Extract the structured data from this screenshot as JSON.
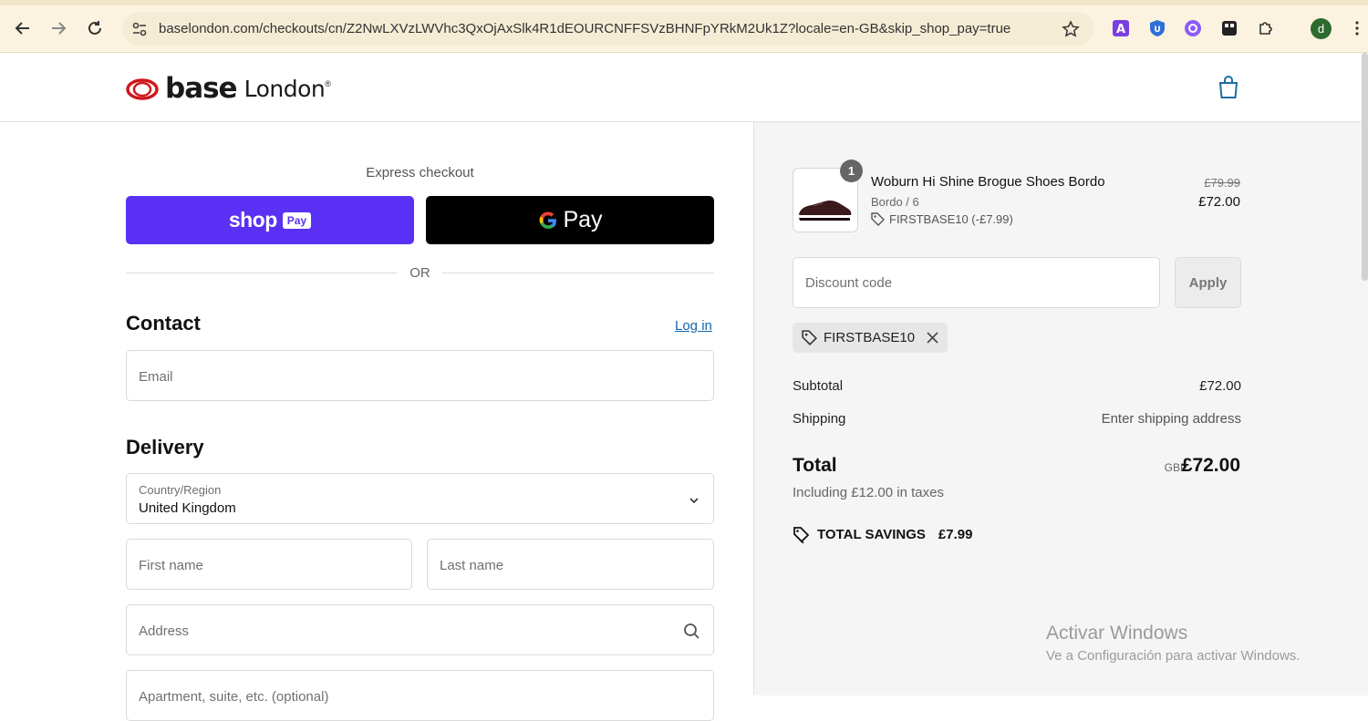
{
  "browser": {
    "url": "baselondon.com/checkouts/cn/Z2NwLXVzLWVhc3QxOjAxSlk4R1dEOURCNFFSVzBHNFpYRkM2Uk1Z?locale=en-GB&skip_shop_pay=true",
    "avatar_letter": "d",
    "extensions": [
      "translate-icon",
      "shield-icon",
      "vpn-icon",
      "tracker-icon",
      "puzzle-icon"
    ]
  },
  "header": {
    "logo_base": "base",
    "logo_london": "London",
    "logo_reg": "®"
  },
  "express": {
    "label": "Express checkout",
    "shoppay_shop": "shop",
    "shoppay_pay": "Pay",
    "gpay_g": "G",
    "gpay_pay": "Pay",
    "or": "OR"
  },
  "contact": {
    "title": "Contact",
    "login": "Log in",
    "email_placeholder": "Email"
  },
  "delivery": {
    "title": "Delivery",
    "country_label": "Country/Region",
    "country_value": "United Kingdom",
    "first_name": "First name",
    "last_name": "Last name",
    "address": "Address",
    "apartment": "Apartment, suite, etc. (optional)"
  },
  "summary": {
    "qty": "1",
    "product_name": "Woburn Hi Shine Brogue Shoes Bordo",
    "variant": "Bordo / 6",
    "discount_line": "FIRSTBASE10 (-£7.99)",
    "price_old": "£79.99",
    "price_new": "£72.00",
    "discount_placeholder": "Discount code",
    "apply": "Apply",
    "applied_code": "FIRSTBASE10",
    "subtotal_label": "Subtotal",
    "subtotal_value": "£72.00",
    "shipping_label": "Shipping",
    "shipping_value": "Enter shipping address",
    "total_label": "Total",
    "total_currency": "GBP",
    "total_value": "£72.00",
    "taxes": "Including £12.00 in taxes",
    "savings_label": "TOTAL SAVINGS",
    "savings_value": "£7.99"
  },
  "watermark": {
    "line1": "Activar Windows",
    "line2": "Ve a Configuración para activar Windows."
  },
  "colors": {
    "shoppay": "#5a31f4",
    "gpay": "#000000",
    "link": "#1666a8",
    "logo_red": "#d0161c"
  }
}
